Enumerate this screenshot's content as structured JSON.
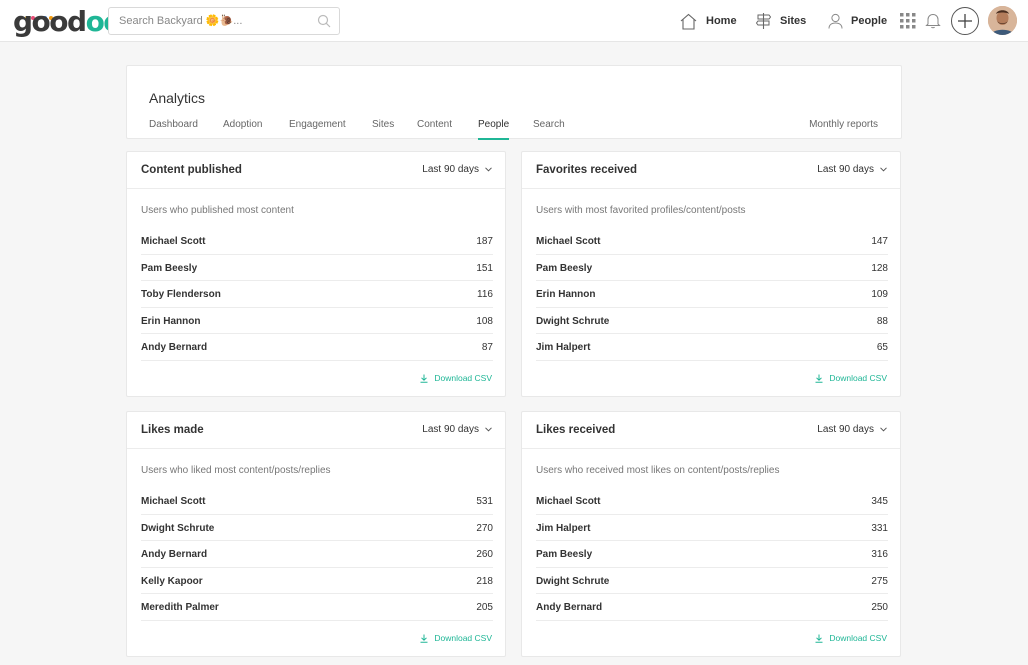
{
  "app": {
    "logo_text": "goodoo",
    "brand_color": "#1fb696",
    "logo_dot_colors": [
      "#f2c12e",
      "#e94e77",
      "#1fb696",
      "#4a90e2",
      "#f39c12",
      "#8e44ad"
    ]
  },
  "header": {
    "search_placeholder": "Search Backyard 🌼🐌...",
    "search_icon": "search-icon",
    "nav": [
      {
        "label": "Home",
        "icon": "home-icon"
      },
      {
        "label": "Sites",
        "icon": "signpost-icon"
      },
      {
        "label": "People",
        "icon": "person-icon"
      }
    ],
    "apps_icon": "grid-icon",
    "notifications_icon": "bell-icon",
    "create_icon": "plus-icon"
  },
  "analytics": {
    "title": "Analytics",
    "tabs": [
      "Dashboard",
      "Adoption",
      "Engagement",
      "Sites",
      "Content",
      "People",
      "Search"
    ],
    "active_tab": "People",
    "monthly_reports": "Monthly reports"
  },
  "cards": [
    {
      "title": "Content published",
      "range": "Last 90 days",
      "subtitle": "Users who published most content",
      "rows": [
        {
          "name": "Michael Scott",
          "value": "187"
        },
        {
          "name": "Pam Beesly",
          "value": "151"
        },
        {
          "name": "Toby Flenderson",
          "value": "116"
        },
        {
          "name": "Erin Hannon",
          "value": "108"
        },
        {
          "name": "Andy Bernard",
          "value": "87"
        }
      ],
      "download": "Download CSV"
    },
    {
      "title": "Favorites received",
      "range": "Last 90 days",
      "subtitle": "Users with most favorited profiles/content/posts",
      "rows": [
        {
          "name": "Michael Scott",
          "value": "147"
        },
        {
          "name": "Pam Beesly",
          "value": "128"
        },
        {
          "name": "Erin Hannon",
          "value": "109"
        },
        {
          "name": "Dwight Schrute",
          "value": "88"
        },
        {
          "name": "Jim Halpert",
          "value": "65"
        }
      ],
      "download": "Download CSV"
    },
    {
      "title": "Likes made",
      "range": "Last 90 days",
      "subtitle": "Users who liked most content/posts/replies",
      "rows": [
        {
          "name": "Michael Scott",
          "value": "531"
        },
        {
          "name": "Dwight Schrute",
          "value": "270"
        },
        {
          "name": "Andy Bernard",
          "value": "260"
        },
        {
          "name": "Kelly Kapoor",
          "value": "218"
        },
        {
          "name": "Meredith Palmer",
          "value": "205"
        }
      ],
      "download": "Download CSV"
    },
    {
      "title": "Likes received",
      "range": "Last 90 days",
      "subtitle": "Users who received most likes on content/posts/replies",
      "rows": [
        {
          "name": "Michael Scott",
          "value": "345"
        },
        {
          "name": "Jim Halpert",
          "value": "331"
        },
        {
          "name": "Pam Beesly",
          "value": "316"
        },
        {
          "name": "Dwight Schrute",
          "value": "275"
        },
        {
          "name": "Andy Bernard",
          "value": "250"
        }
      ],
      "download": "Download CSV"
    }
  ]
}
